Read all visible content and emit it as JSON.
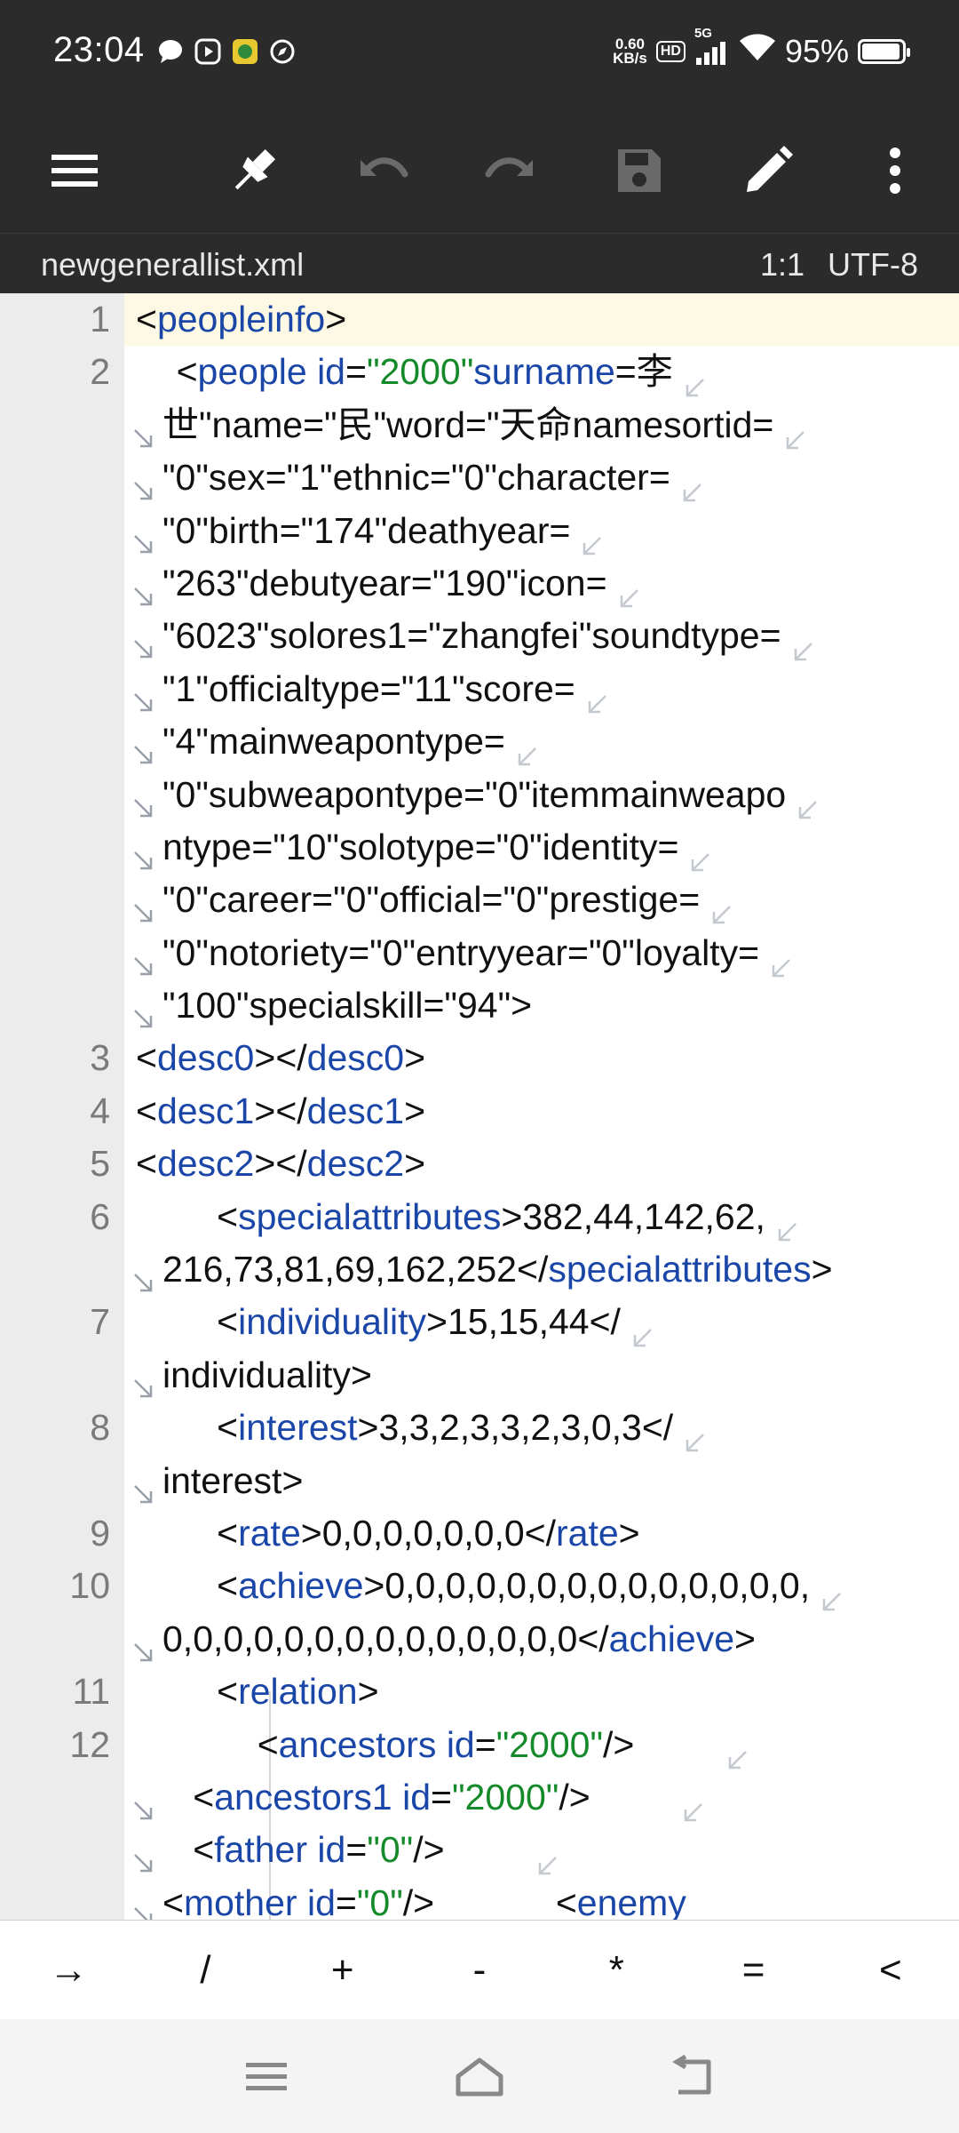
{
  "status_bar": {
    "time": "23:04",
    "notification_icons": [
      "chat-bubble-icon",
      "play-app-icon",
      "game-app-icon",
      "compass-app-icon"
    ],
    "net_speed_value": "0.60",
    "net_speed_unit": "KB/s",
    "hd_label": "HD",
    "network_label": "5G",
    "battery_percent": "95%",
    "battery_level": 0.95
  },
  "toolbar": {
    "icons": [
      "menu-icon",
      "pin-icon",
      "undo-icon",
      "redo-icon",
      "save-icon",
      "edit-pencil-icon",
      "more-vert-icon"
    ]
  },
  "file_bar": {
    "filename": "newgenerallist.xml",
    "cursor_position": "1:1",
    "encoding": "UTF-8"
  },
  "editor": {
    "lines": [
      {
        "num": "1",
        "code": "<peopleinfo>"
      },
      {
        "num": "2",
        "code": "    <people id=\"2000\"surname=\"李世\"name=\"民\"word=\"天命\"namesortid=\"0\"sex=\"1\"ethnic=\"0\"character=\"0\"birth=\"174\"deathyear=\"263\"debutyear=\"190\"icon=\"6023\"solores1=\"zhangfei\"soundtype=\"1\"officialtype=\"11\"score=\"4\"mainweapontype=\"0\"subweapontype=\"0\"itemmainweapontype=\"10\"solotype=\"0\"identity=\"0\"career=\"0\"official=\"0\"prestige=\"0\"notoriety=\"0\"entryyear=\"0\"loyalty=\"100\"specialskill=\"94\">"
      },
      {
        "num": "3",
        "code": "<desc0></desc0>"
      },
      {
        "num": "4",
        "code": "<desc1></desc1>"
      },
      {
        "num": "5",
        "code": "<desc2></desc2>"
      },
      {
        "num": "6",
        "code": "        <specialattributes>382,44,142,62,216,73,81,69,162,252</specialattributes>"
      },
      {
        "num": "7",
        "code": "        <individuality>15,15,44</individuality>"
      },
      {
        "num": "8",
        "code": "        <interest>3,3,2,3,3,2,3,0,3</interest>"
      },
      {
        "num": "9",
        "code": "        <rate>0,0,0,0,0,0,0</rate>"
      },
      {
        "num": "10",
        "code": "        <achieve>0,0,0,0,0,0,0,0,0,0,0,0,0,0,0,0,0,0,0,0,0,0,0,0,0,0,0,0</achieve>"
      },
      {
        "num": "11",
        "code": "        <relation>"
      },
      {
        "num": "12",
        "code": "            <ancestors id=\"2000\"/>                <ancestors1 id=\"2000\"/>                <father id=\"0\"/>                <mother id=\"0\"/>                <enemy"
      }
    ]
  },
  "keys": [
    "→",
    "/",
    "+",
    "-",
    "*",
    "=",
    "<"
  ],
  "nav_bar": {
    "icons": [
      "recents-menu-icon",
      "home-icon",
      "back-icon"
    ]
  }
}
